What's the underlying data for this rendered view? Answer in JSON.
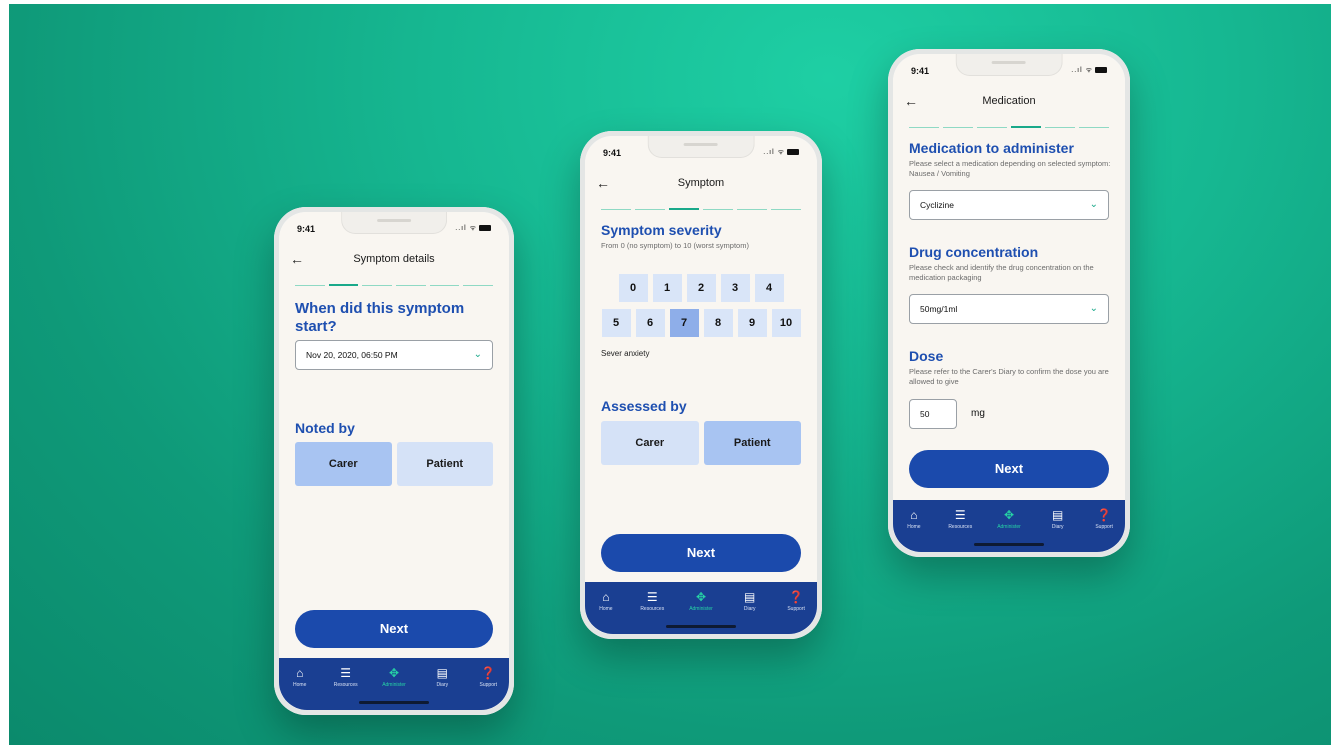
{
  "status": {
    "time": "9:41",
    "signal": "..ıl ᯤ"
  },
  "nav_labels": [
    {
      "name": "Home",
      "icon": "home-icon",
      "glyph": "⌂"
    },
    {
      "name": "Resources",
      "icon": "list-icon",
      "glyph": "☰"
    },
    {
      "name": "Administer",
      "icon": "administer-icon",
      "glyph": "✥"
    },
    {
      "name": "Diary",
      "icon": "diary-icon",
      "glyph": "▤"
    },
    {
      "name": "Support",
      "icon": "help-icon",
      "glyph": "❓"
    }
  ],
  "colors": {
    "accent": "#1aa98a",
    "primary": "#1b4aac",
    "tabbar": "#1a3f92",
    "background": "#16b791"
  },
  "phone1": {
    "title": "Symptom details",
    "back": "←",
    "question": "When did this symptom start?",
    "datetime_value": "Nov 20, 2020, 06:50 PM",
    "noted_by_label": "Noted by",
    "options": [
      "Carer",
      "Patient"
    ],
    "selected": "Carer",
    "next": "Next"
  },
  "phone2": {
    "title": "Symptom",
    "back": "←",
    "heading": "Symptom severity",
    "subtitle": "From 0 (no symptom) to 10 (worst symptom)",
    "row1": [
      "0",
      "1",
      "2",
      "3",
      "4"
    ],
    "row2": [
      "5",
      "6",
      "7",
      "8",
      "9",
      "10"
    ],
    "selected_value": "7",
    "severity_text": "Sever anxiety",
    "assessed_by_label": "Assessed by",
    "options": [
      "Carer",
      "Patient"
    ],
    "selected": "Patient",
    "next": "Next"
  },
  "phone3": {
    "title": "Medication",
    "back": "←",
    "med_heading": "Medication to administer",
    "med_sub": "Please select a medication depending on selected symptom: Nausea / Vomiting",
    "med_value": "Cyclizine",
    "conc_heading": "Drug concentration",
    "conc_sub": "Please check and identify the drug concentration on the medication packaging",
    "conc_value": "50mg/1ml",
    "dose_heading": "Dose",
    "dose_sub": "Please refer to the Carer's Diary to confirm the dose you are allowed to give",
    "dose_value": "50",
    "dose_unit": "mg",
    "next": "Next"
  }
}
